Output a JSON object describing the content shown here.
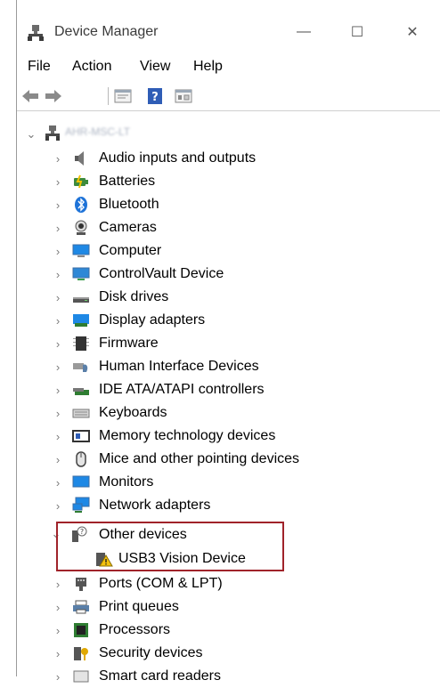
{
  "window": {
    "title": "Device Manager",
    "controls": {
      "minimize": "—",
      "maximize": "☐",
      "close": "✕"
    }
  },
  "menubar": {
    "items": [
      "File",
      "Action",
      "View",
      "Help"
    ]
  },
  "toolbar": {
    "buttons": [
      "back-arrow-icon",
      "forward-arrow-icon",
      "properties-icon",
      "help-icon",
      "show-hidden-icon"
    ]
  },
  "tree": {
    "root_label": "AHR-MSC-LT",
    "categories": [
      {
        "label": "Audio inputs and outputs",
        "icon": "speaker-icon",
        "expanded": false
      },
      {
        "label": "Batteries",
        "icon": "battery-icon",
        "expanded": false
      },
      {
        "label": "Bluetooth",
        "icon": "bluetooth-icon",
        "expanded": false
      },
      {
        "label": "Cameras",
        "icon": "camera-icon",
        "expanded": false
      },
      {
        "label": "Computer",
        "icon": "computer-icon",
        "expanded": false
      },
      {
        "label": "ControlVault Device",
        "icon": "controlvault-icon",
        "expanded": false
      },
      {
        "label": "Disk drives",
        "icon": "disk-drive-icon",
        "expanded": false
      },
      {
        "label": "Display adapters",
        "icon": "display-adapter-icon",
        "expanded": false
      },
      {
        "label": "Firmware",
        "icon": "firmware-icon",
        "expanded": false
      },
      {
        "label": "Human Interface Devices",
        "icon": "hid-icon",
        "expanded": false
      },
      {
        "label": "IDE ATA/ATAPI controllers",
        "icon": "ide-controller-icon",
        "expanded": false
      },
      {
        "label": "Keyboards",
        "icon": "keyboard-icon",
        "expanded": false
      },
      {
        "label": "Memory technology devices",
        "icon": "memory-icon",
        "expanded": false
      },
      {
        "label": "Mice and other pointing devices",
        "icon": "mouse-icon",
        "expanded": false
      },
      {
        "label": "Monitors",
        "icon": "monitor-icon",
        "expanded": false
      },
      {
        "label": "Network adapters",
        "icon": "network-icon",
        "expanded": false
      },
      {
        "label": "Other devices",
        "icon": "other-devices-icon",
        "expanded": true,
        "children": [
          {
            "label": "USB3 Vision Device",
            "icon": "warning-device-icon"
          }
        ]
      },
      {
        "label": "Ports (COM & LPT)",
        "icon": "port-icon",
        "expanded": false
      },
      {
        "label": "Print queues",
        "icon": "printer-icon",
        "expanded": false
      },
      {
        "label": "Processors",
        "icon": "processor-icon",
        "expanded": false
      },
      {
        "label": "Security devices",
        "icon": "security-icon",
        "expanded": false
      },
      {
        "label": "Smart card readers",
        "icon": "smart-card-icon",
        "expanded": false
      }
    ]
  },
  "colors": {
    "highlight_box": "#a0232a",
    "accent_blue": "#1e88e5",
    "chevron": "#7a7a7a"
  }
}
